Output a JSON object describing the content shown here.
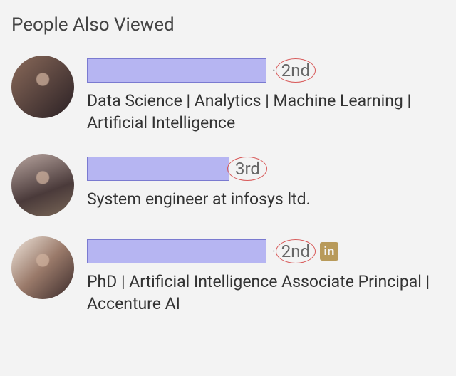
{
  "section_title": "People Also Viewed",
  "people": [
    {
      "name_redacted_width": 252,
      "degree": "2nd",
      "show_dot": true,
      "has_in_badge": false,
      "headline": "Data Science | Analytics | Machine Learning | Artificial Intelligence"
    },
    {
      "name_redacted_width": 200,
      "degree": "3rd",
      "show_dot": false,
      "has_in_badge": false,
      "headline": "System engineer at infosys ltd."
    },
    {
      "name_redacted_width": 252,
      "degree": "2nd",
      "show_dot": true,
      "has_in_badge": true,
      "headline": "PhD | Artificial Intelligence Associate Principal | Accenture AI"
    }
  ],
  "in_badge_text": "in"
}
